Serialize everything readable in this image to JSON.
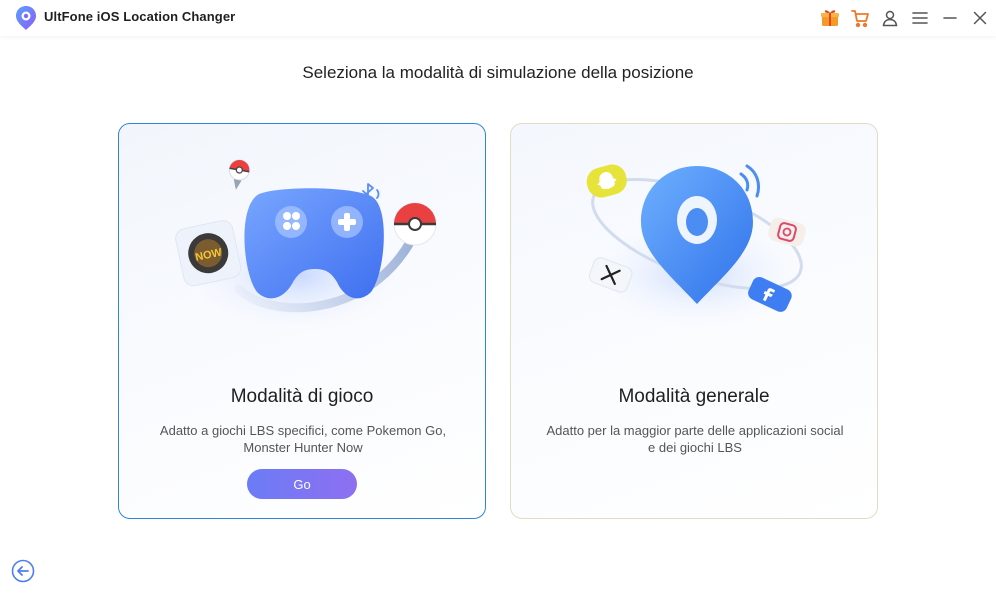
{
  "app": {
    "title": "UltFone iOS Location Changer",
    "logo_icon": "location-pin-logo",
    "accent_color": "#2f86d6"
  },
  "titlebar": {
    "icons": [
      "gift-icon",
      "cart-icon",
      "user-icon",
      "menu-icon",
      "minimize-icon",
      "close-icon"
    ]
  },
  "main": {
    "heading": "Seleziona la modalità di simulazione della posizione"
  },
  "cards": {
    "game": {
      "title": "Modalità di gioco",
      "description_line1": "Adatto a giochi LBS specifici, come Pokemon Go,",
      "description_line2": "Monster Hunter Now",
      "button_label": "Go",
      "selected": true,
      "badge_text": "NOW"
    },
    "general": {
      "title": "Modalità generale",
      "description_line1": "Adatto per la maggior parte delle applicazioni social",
      "description_line2": "e dei giochi LBS"
    }
  },
  "footer": {
    "back_icon": "back-arrow-icon"
  }
}
